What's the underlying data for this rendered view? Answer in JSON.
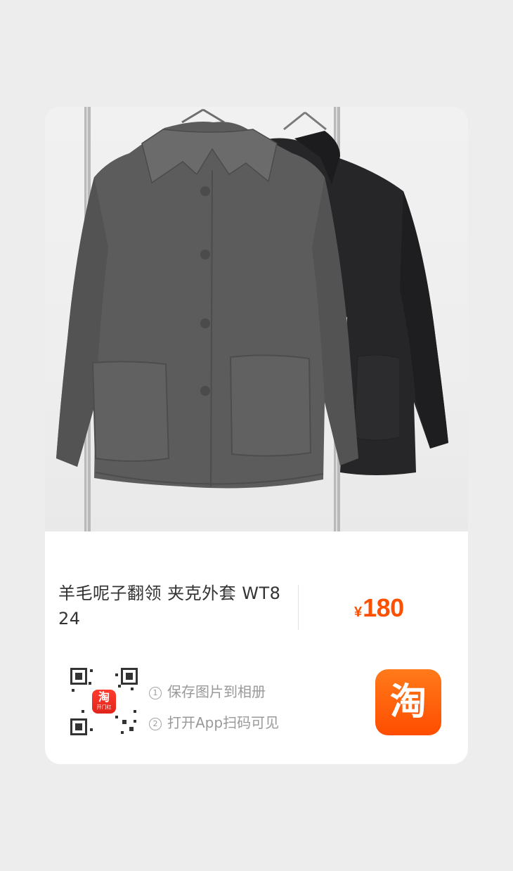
{
  "product": {
    "title": "羊毛呢子翻领 夹克外套 WT824",
    "price_currency": "¥",
    "price_amount": "180"
  },
  "qr": {
    "logo_main": "淘",
    "logo_sub": "开门红"
  },
  "steps": [
    {
      "num": "1",
      "text": "保存图片到相册"
    },
    {
      "num": "2",
      "text": "打开App扫码可见"
    }
  ],
  "app_button": {
    "label": "淘",
    "color": "#ff5000"
  },
  "colors": {
    "price": "#ff5000",
    "background": "#ededed"
  }
}
